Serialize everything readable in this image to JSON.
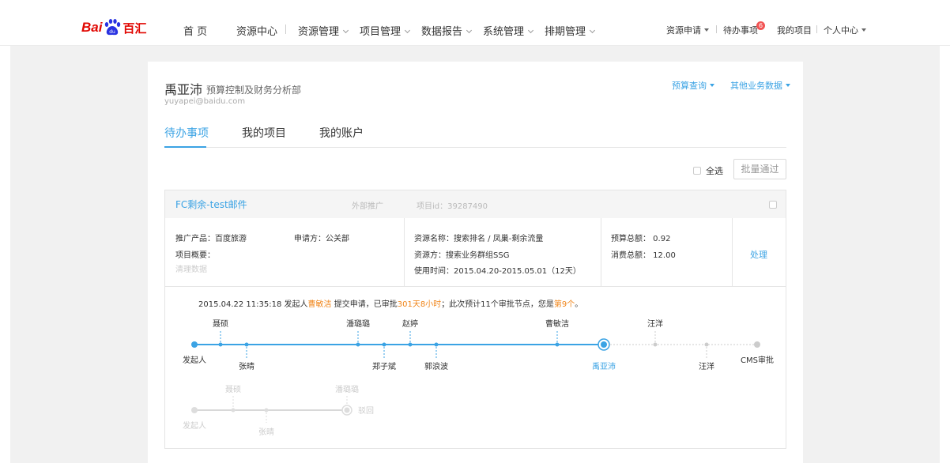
{
  "header": {
    "logo_text": "Bai",
    "logo_suffix": "百汇",
    "nav": [
      "首 页",
      "资源中心",
      "资源管理",
      "项目管理",
      "数据报告",
      "系统管理",
      "排期管理"
    ],
    "right_nav": {
      "apply": "资源申请",
      "todo": "待办事项",
      "todo_badge": "6",
      "my_projects": "我的项目",
      "personal": "个人中心"
    }
  },
  "profile": {
    "name": "禹亚沛",
    "dept": "预算控制及财务分析部",
    "email": "yuyapei@baidu.com",
    "links": [
      "预算查询",
      "其他业务数据"
    ]
  },
  "tabs": [
    "待办事项",
    "我的项目",
    "我的账户"
  ],
  "toolbar": {
    "select_all": "全选",
    "batch_approve": "批量通过"
  },
  "card": {
    "title": "FC剩余-test邮件",
    "channel": "外部推广",
    "project_id": "项目id：39287490",
    "product": "推广产品：百度旅游",
    "applicant": "申请方：公关部",
    "overview_label": "项目概要：",
    "overview_value": "清理数据",
    "resource_name": "资源名称：搜索排名 / 凤巢-剩余流量",
    "resource_owner": "资源方：搜索业务群组SSG",
    "usage_time": "使用时间：2015.04.20-2015.05.01（12天）",
    "budget_total": "预算总额： 0.92",
    "spend_total": "消费总额： 12.00",
    "action": "处理"
  },
  "timeline": {
    "ts": "2015.04.22 11:35:18",
    "initiator_label": "发起人",
    "initiator": "曹敏洁",
    "msg1": "提交申请，已审批",
    "elapsed": "301天8小时",
    "msg2": "；此次预计11个审批节点，您是",
    "position": "第9个",
    "msg3": "。",
    "nodes_above": [
      "聂硕",
      "潘璐璐",
      "赵婷",
      "曹敏洁",
      "汪洋"
    ],
    "nodes_below": [
      "发起人",
      "张晴",
      "郑子斌",
      "郭浪波",
      "禹亚沛",
      "汪洋",
      "CMS审批"
    ],
    "old_above": [
      "聂硕",
      "潘璐璐"
    ],
    "old_below": [
      "发起人",
      "张晴"
    ],
    "old_end": "驳回"
  },
  "colors": {
    "accent": "#3ba3e4",
    "highlight": "#f08519",
    "brand": "#e10601"
  }
}
